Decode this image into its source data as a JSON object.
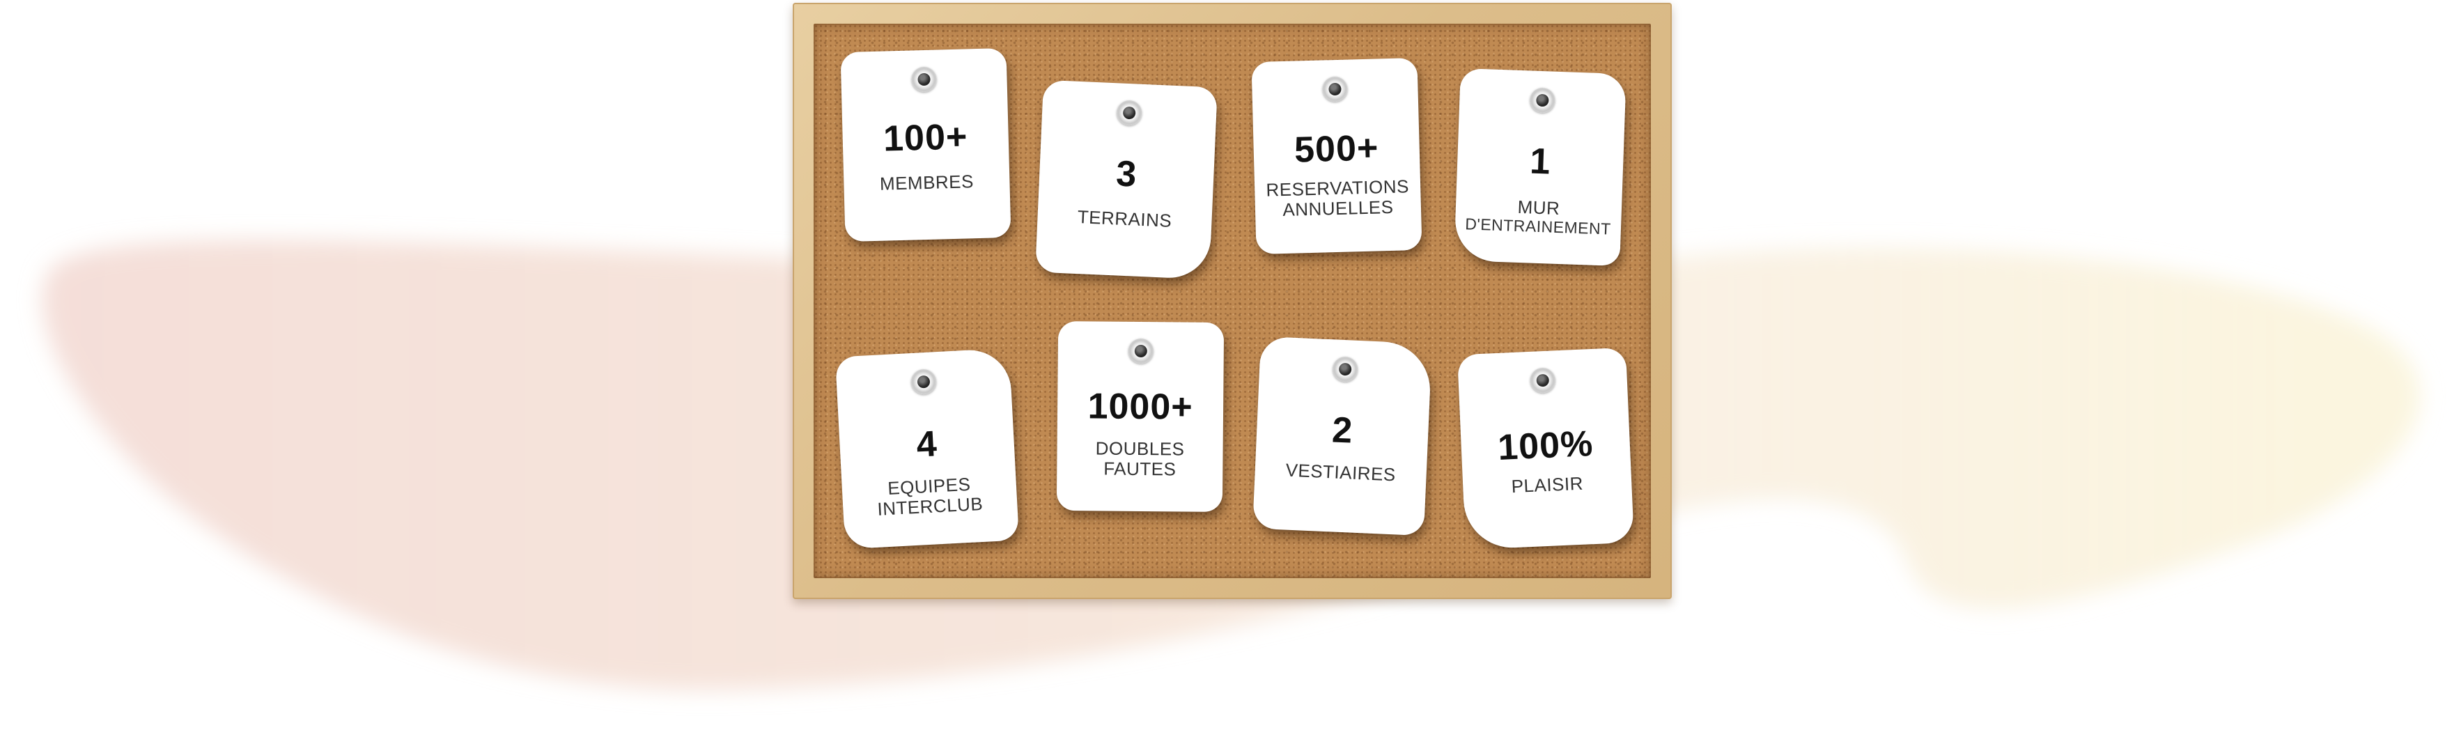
{
  "colors": {
    "cork": "#c08a52",
    "frame": "#dcbd8a",
    "card": "#ffffff",
    "text": "#111111",
    "blob_left": "#f3d8c8",
    "blob_right": "#f8f0d6"
  },
  "cards": [
    {
      "value": "100+",
      "label": [
        "MEMBRES"
      ]
    },
    {
      "value": "3",
      "label": [
        "TERRAINS"
      ]
    },
    {
      "value": "500+",
      "label": [
        "RESERVATIONS",
        "ANNUELLES"
      ]
    },
    {
      "value": "1",
      "label": [
        "MUR",
        "D'ENTRAINEMENT"
      ]
    },
    {
      "value": "4",
      "label": [
        "EQUIPES",
        "INTERCLUB"
      ]
    },
    {
      "value": "1000+",
      "label": [
        "DOUBLES",
        "FAUTES"
      ]
    },
    {
      "value": "2",
      "label": [
        "VESTIAIRES"
      ]
    },
    {
      "value": "100%",
      "label": [
        "PLAISIR"
      ]
    }
  ]
}
